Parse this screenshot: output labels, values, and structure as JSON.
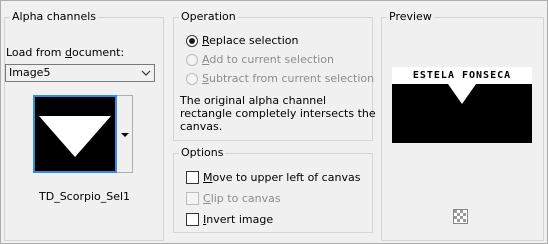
{
  "alpha": {
    "title": "Alpha channels",
    "load_label_pre": "Load from ",
    "load_label_u": "d",
    "load_label_post": "ocument:",
    "document": "Image5",
    "channel_name": "TD_Scorpio_Sel1"
  },
  "operation": {
    "title": "Operation",
    "options": [
      {
        "pre": "",
        "u": "R",
        "post": "eplace selection",
        "selected": true,
        "enabled": true
      },
      {
        "pre": "",
        "u": "A",
        "post": "dd to current selection",
        "selected": false,
        "enabled": false
      },
      {
        "pre": "",
        "u": "S",
        "post": "ubtract from current selection",
        "selected": false,
        "enabled": false
      }
    ],
    "info_line1": "The original alpha channel",
    "info_line2": "rectangle completely intersects the",
    "info_line3": "canvas."
  },
  "options": {
    "title": "Options",
    "items": [
      {
        "pre": "",
        "u": "M",
        "post": "ove to upper left of canvas",
        "checked": false,
        "enabled": true
      },
      {
        "pre": "",
        "u": "C",
        "post": "lip to canvas",
        "checked": false,
        "enabled": false
      },
      {
        "pre": "",
        "u": "I",
        "post": "nvert image",
        "checked": false,
        "enabled": true
      }
    ]
  },
  "preview": {
    "title": "Preview",
    "watermark": "ESTELA FONSECA",
    "zoom_icon": "checkerboard-icon"
  }
}
